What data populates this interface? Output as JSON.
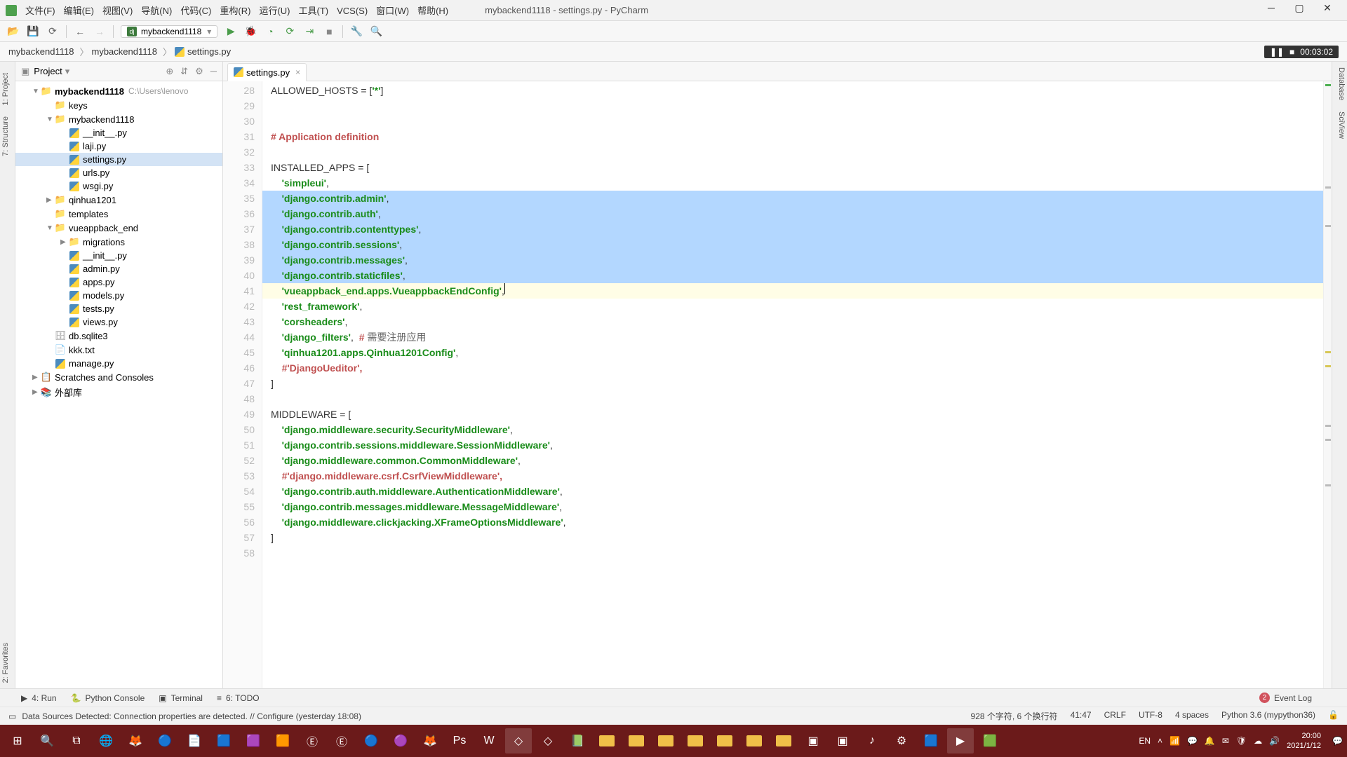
{
  "app": {
    "title": "mybackend1118 - settings.py - PyCharm",
    "menus": [
      "文件(F)",
      "编辑(E)",
      "视图(V)",
      "导航(N)",
      "代码(C)",
      "重构(R)",
      "运行(U)",
      "工具(T)",
      "VCS(S)",
      "窗口(W)",
      "帮助(H)"
    ],
    "run_config": "mybackend1118",
    "timer": "00:03:02"
  },
  "breadcrumb": [
    "mybackend1118",
    "mybackend1118",
    "settings.py"
  ],
  "project_panel": {
    "title": "Project",
    "root": "mybackend1118",
    "root_path": "C:\\Users\\lenovo"
  },
  "tree": [
    {
      "ind": 1,
      "type": "folder",
      "label": "mybackend1118",
      "arrow": "▼",
      "bold": true,
      "path": "C:\\Users\\lenovo"
    },
    {
      "ind": 2,
      "type": "folder",
      "label": "keys",
      "arrow": ""
    },
    {
      "ind": 2,
      "type": "folder",
      "label": "mybackend1118",
      "arrow": "▼"
    },
    {
      "ind": 3,
      "type": "py",
      "label": "__init__.py"
    },
    {
      "ind": 3,
      "type": "py",
      "label": "laji.py"
    },
    {
      "ind": 3,
      "type": "py",
      "label": "settings.py",
      "selected": true
    },
    {
      "ind": 3,
      "type": "py",
      "label": "urls.py"
    },
    {
      "ind": 3,
      "type": "py",
      "label": "wsgi.py"
    },
    {
      "ind": 2,
      "type": "folder",
      "label": "qinhua1201",
      "arrow": "▶"
    },
    {
      "ind": 2,
      "type": "folder",
      "label": "templates",
      "arrow": ""
    },
    {
      "ind": 2,
      "type": "folder",
      "label": "vueappback_end",
      "arrow": "▼"
    },
    {
      "ind": 3,
      "type": "folder",
      "label": "migrations",
      "arrow": "▶"
    },
    {
      "ind": 3,
      "type": "py",
      "label": "__init__.py"
    },
    {
      "ind": 3,
      "type": "py",
      "label": "admin.py"
    },
    {
      "ind": 3,
      "type": "py",
      "label": "apps.py"
    },
    {
      "ind": 3,
      "type": "py",
      "label": "models.py"
    },
    {
      "ind": 3,
      "type": "py",
      "label": "tests.py"
    },
    {
      "ind": 3,
      "type": "py",
      "label": "views.py"
    },
    {
      "ind": 2,
      "type": "db",
      "label": "db.sqlite3"
    },
    {
      "ind": 2,
      "type": "txt",
      "label": "kkk.txt"
    },
    {
      "ind": 2,
      "type": "py",
      "label": "manage.py"
    },
    {
      "ind": 1,
      "type": "scratch",
      "label": "Scratches and Consoles",
      "arrow": "▶"
    },
    {
      "ind": 1,
      "type": "ext",
      "label": "外部库",
      "arrow": "▶"
    }
  ],
  "editor": {
    "tab": "settings.py",
    "first_line": 28,
    "lines": [
      {
        "n": 28,
        "html": "<span class='id'>ALLOWED_HOSTS</span> <span class='op'>=</span> [<span class='str'>'*'</span>]"
      },
      {
        "n": 29,
        "html": ""
      },
      {
        "n": 30,
        "html": ""
      },
      {
        "n": 31,
        "html": "<span class='cmt'># Application definition</span>"
      },
      {
        "n": 32,
        "html": ""
      },
      {
        "n": 33,
        "html": "<span class='id'>INSTALLED_APPS</span> <span class='op'>=</span> ["
      },
      {
        "n": 34,
        "html": "    <span class='str'>'simpleui'</span>,"
      },
      {
        "n": 35,
        "html": "    <span class='str'>'django.contrib.admin'</span>,",
        "sel": true
      },
      {
        "n": 36,
        "html": "    <span class='str'>'django.contrib.auth'</span>,",
        "sel": true
      },
      {
        "n": 37,
        "html": "    <span class='str'>'django.contrib.contenttypes'</span>,",
        "sel": true
      },
      {
        "n": 38,
        "html": "    <span class='str'>'django.contrib.sessions'</span>,",
        "sel": true
      },
      {
        "n": 39,
        "html": "    <span class='str'>'django.contrib.messages'</span>,",
        "sel": true
      },
      {
        "n": 40,
        "html": "    <span class='str'>'django.contrib.staticfiles'</span>,",
        "sel": true
      },
      {
        "n": 41,
        "html": "    <span class='str'>'vueappback_end.apps.VueappbackEndConfig'</span>,<span class='cursor'></span>",
        "sel": true,
        "cur": true,
        "bulb": true
      },
      {
        "n": 42,
        "html": "    <span class='str'>'rest_framework'</span>,"
      },
      {
        "n": 43,
        "html": "    <span class='str'>'corsheaders'</span>,"
      },
      {
        "n": 44,
        "html": "    <span class='str'>'django_filters'</span>,  <span class='cmt'># </span><span class='cmt-cn'>需要注册应用</span>"
      },
      {
        "n": 45,
        "html": "    <span class='str'>'qinhua1201.apps.Qinhua1201Config'</span>,"
      },
      {
        "n": 46,
        "html": "    <span class='cmt'>#'DjangoUeditor',</span>"
      },
      {
        "n": 47,
        "html": "]"
      },
      {
        "n": 48,
        "html": ""
      },
      {
        "n": 49,
        "html": "<span class='id'>MIDDLEWARE</span> <span class='op'>=</span> ["
      },
      {
        "n": 50,
        "html": "    <span class='str'>'django.middleware.security.SecurityMiddleware'</span>,"
      },
      {
        "n": 51,
        "html": "    <span class='str'>'django.contrib.sessions.middleware.SessionMiddleware'</span>,"
      },
      {
        "n": 52,
        "html": "    <span class='str'>'django.middleware.common.CommonMiddleware'</span>,"
      },
      {
        "n": 53,
        "html": "    <span class='cmt'>#'django.middleware.csrf.CsrfViewMiddleware',</span>"
      },
      {
        "n": 54,
        "html": "    <span class='str'>'django.contrib.auth.middleware.AuthenticationMiddleware'</span>,"
      },
      {
        "n": 55,
        "html": "    <span class='str'>'django.contrib.messages.middleware.MessageMiddleware'</span>,"
      },
      {
        "n": 56,
        "html": "    <span class='str'>'django.middleware.clickjacking.XFrameOptionsMiddleware'</span>,"
      },
      {
        "n": 57,
        "html": "]"
      },
      {
        "n": 58,
        "html": ""
      }
    ]
  },
  "bottom_tools": {
    "run": "4: Run",
    "python_console": "Python Console",
    "terminal": "Terminal",
    "todo": "6: TODO",
    "event_log": "Event Log",
    "event_count": "2"
  },
  "status": {
    "message": "Data Sources Detected: Connection properties are detected. // Configure (yesterday 18:08)",
    "sel": "928 个字符, 6 个换行符",
    "pos": "41:47",
    "eol": "CRLF",
    "enc": "UTF-8",
    "indent": "4 spaces",
    "sdk": "Python 3.6 (mypython36)"
  },
  "side_tabs_left": [
    "1: Project",
    "7: Structure",
    "2: Favorites"
  ],
  "side_tabs_right": [
    "Database",
    "SciView"
  ],
  "taskbar": {
    "time": "20:00",
    "date": "2021/1/12",
    "ime": "EN"
  }
}
